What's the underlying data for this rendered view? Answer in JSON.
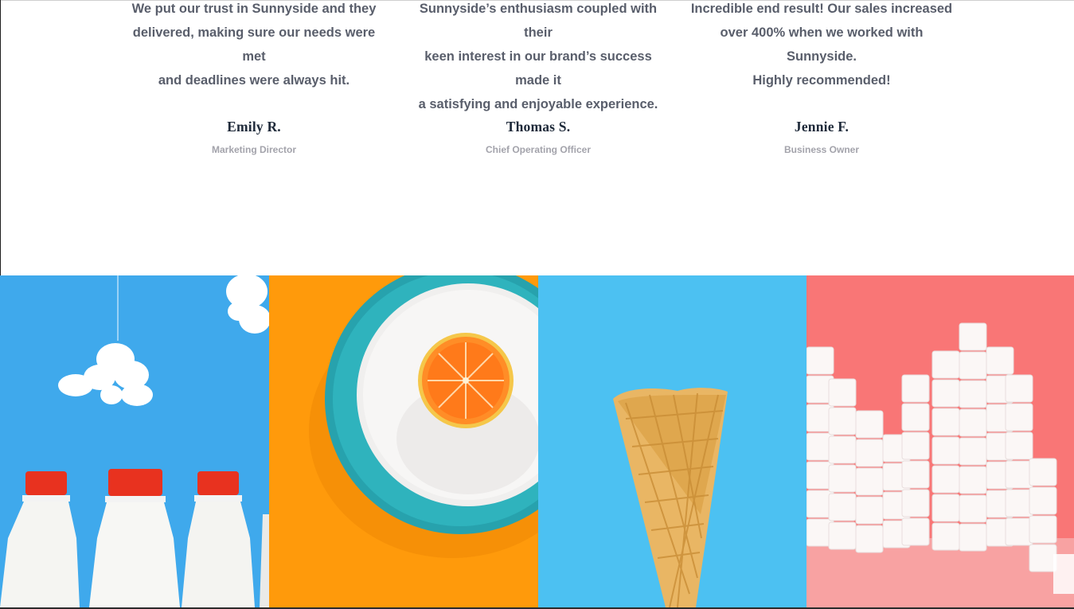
{
  "testimonials": [
    {
      "quote_lines": [
        "We put our trust in Sunnyside and they",
        "delivered, making sure our needs were met",
        "and deadlines were always hit."
      ],
      "name": "Emily R.",
      "role": "Marketing Director"
    },
    {
      "quote_lines": [
        "Sunnyside’s enthusiasm coupled with their",
        "keen interest in our brand’s success made it",
        "a satisfying and enjoyable experience."
      ],
      "name": "Thomas S.",
      "role": "Chief Operating Officer"
    },
    {
      "quote_lines": [
        "Incredible end result! Our sales increased",
        "over 400% when we worked with Sunnyside.",
        "Highly recommended!"
      ],
      "name": "Jennie F.",
      "role": "Business Owner"
    }
  ],
  "gallery": {
    "colors": {
      "milk_bg": "#3fa9ec",
      "orange_bg": "#ff9a0b",
      "cone_bg": "#4cc1f2",
      "sugar_bg": "#f97676"
    }
  }
}
